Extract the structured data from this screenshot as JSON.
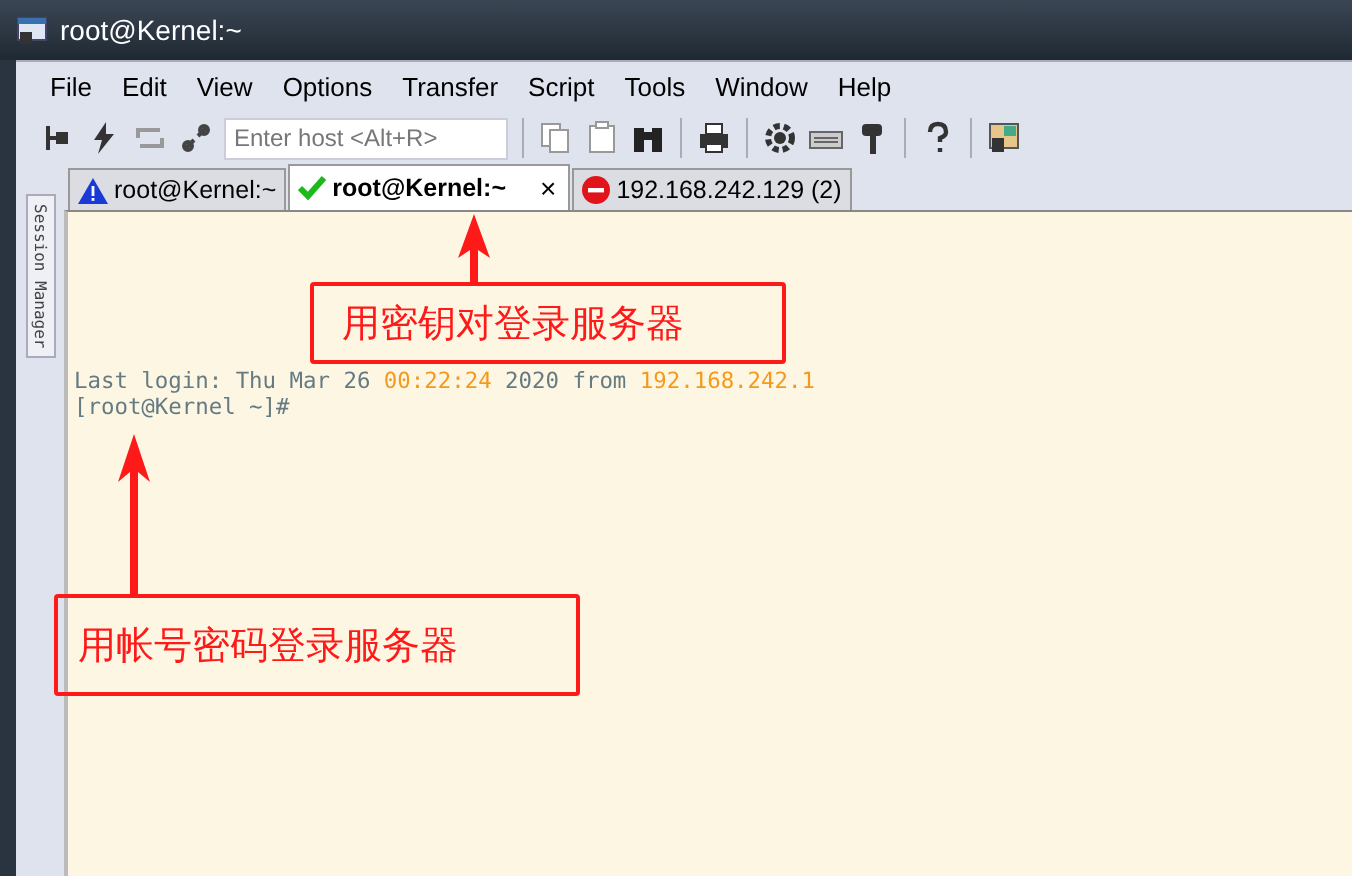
{
  "window": {
    "title": "root@Kernel:~"
  },
  "menu": [
    "File",
    "Edit",
    "View",
    "Options",
    "Transfer",
    "Script",
    "Tools",
    "Window",
    "Help"
  ],
  "toolbar": {
    "host_field": {
      "placeholder": "Enter host <Alt+R>"
    }
  },
  "tabs": [
    {
      "label": "root@Kernel:~",
      "kind": "warning",
      "selected": false
    },
    {
      "label": "root@Kernel:~",
      "kind": "ok",
      "selected": true,
      "close": "×"
    },
    {
      "label": "192.168.242.129 (2)",
      "kind": "error",
      "selected": false
    }
  ],
  "session_manager": {
    "label": "Session Manager"
  },
  "terminal": {
    "lines": [
      [
        {
          "text": "Last login: Thu Mar 26 ",
          "highlight": false
        },
        {
          "text": "00:22:24",
          "highlight": true
        },
        {
          "text": " 2020 from ",
          "highlight": false
        },
        {
          "text": "192.168.242.1",
          "highlight": true
        }
      ],
      [
        {
          "text": "[root@Kernel ~]#",
          "highlight": false
        }
      ]
    ]
  },
  "annotations": [
    {
      "text": "用密钥对登录服务器",
      "kind": "tab"
    },
    {
      "text": "用帐号密码登录服务器",
      "kind": "terminal"
    }
  ]
}
